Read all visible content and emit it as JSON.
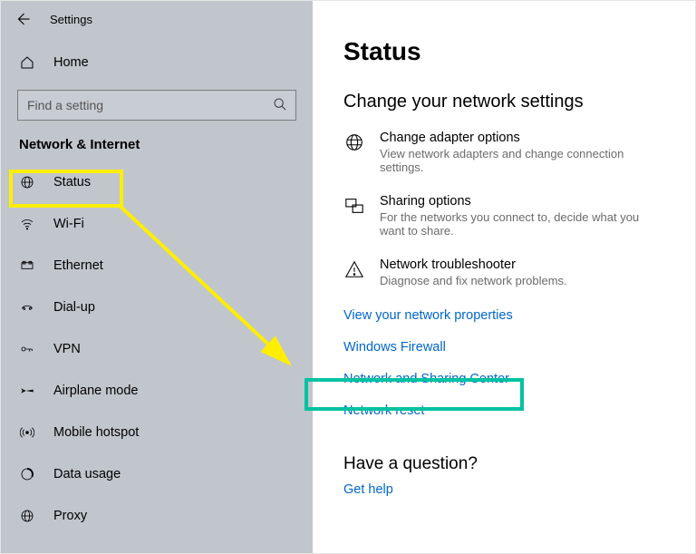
{
  "titlebar": {
    "title": "Settings"
  },
  "home": {
    "label": "Home"
  },
  "search": {
    "placeholder": "Find a setting"
  },
  "section": {
    "header": "Network & Internet"
  },
  "nav": {
    "items": [
      {
        "label": "Status"
      },
      {
        "label": "Wi-Fi"
      },
      {
        "label": "Ethernet"
      },
      {
        "label": "Dial-up"
      },
      {
        "label": "VPN"
      },
      {
        "label": "Airplane mode"
      },
      {
        "label": "Mobile hotspot"
      },
      {
        "label": "Data usage"
      },
      {
        "label": "Proxy"
      }
    ]
  },
  "main": {
    "title": "Status",
    "subheading": "Change your network settings",
    "options": [
      {
        "title": "Change adapter options",
        "desc": "View network adapters and change connection settings."
      },
      {
        "title": "Sharing options",
        "desc": "For the networks you connect to, decide what you want to share."
      },
      {
        "title": "Network troubleshooter",
        "desc": "Diagnose and fix network problems."
      }
    ],
    "links": [
      "View your network properties",
      "Windows Firewall",
      "Network and Sharing Center",
      "Network reset"
    ],
    "question": "Have a question?",
    "gethelp": "Get help"
  }
}
